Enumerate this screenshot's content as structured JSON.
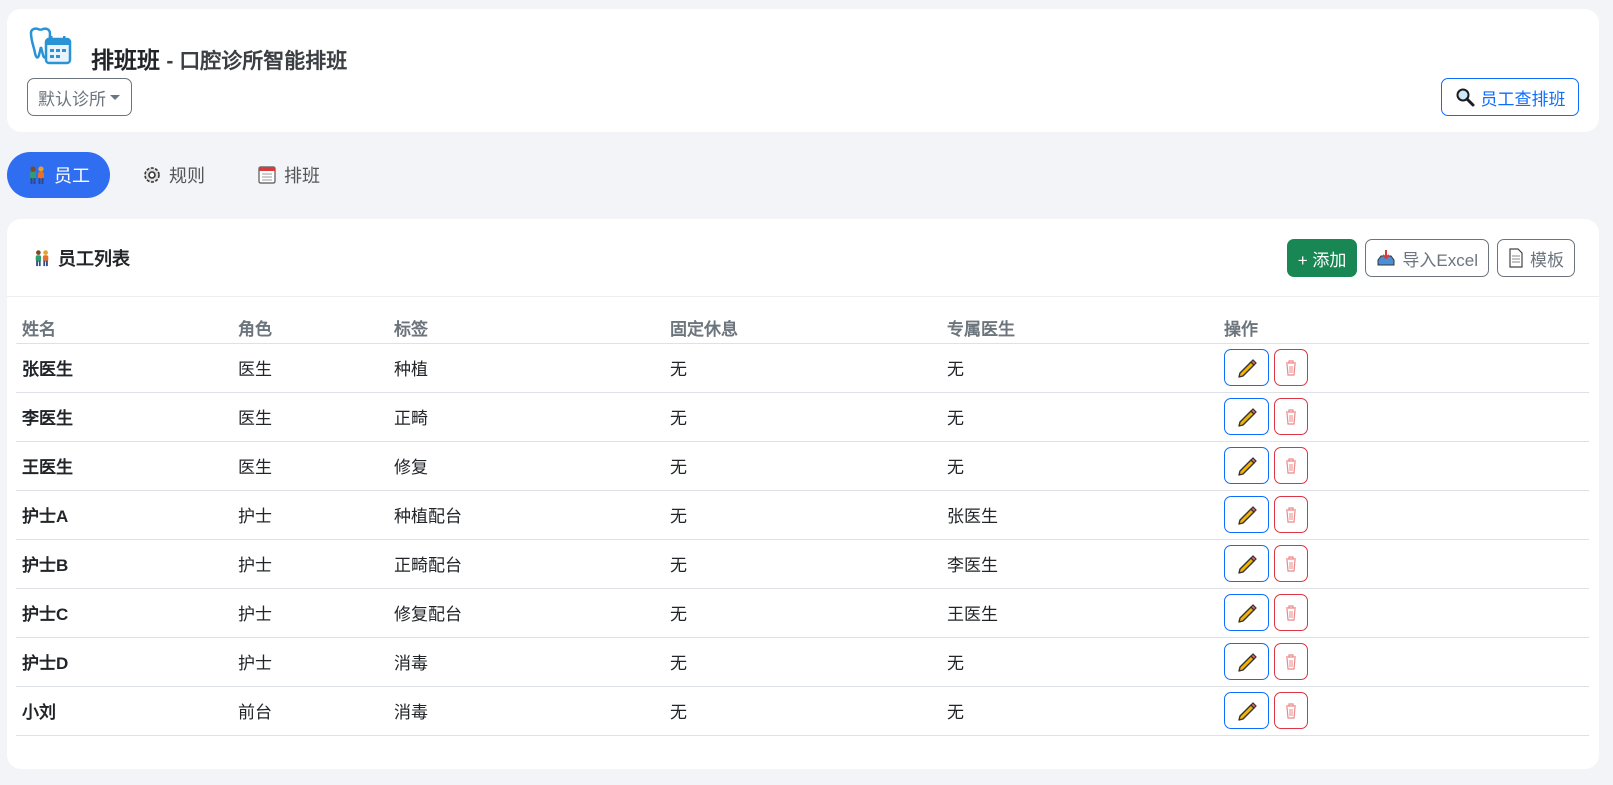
{
  "header": {
    "app_name": "排班班",
    "app_subtitle": "- 口腔诊所智能排班",
    "clinic_select": "默认诊所",
    "lookup_button": "员工查排班"
  },
  "tabs": [
    {
      "label": "员工",
      "icon": "people-icon",
      "active": true
    },
    {
      "label": "规则",
      "icon": "gear-icon",
      "active": false
    },
    {
      "label": "排班",
      "icon": "calendar-icon",
      "active": false
    }
  ],
  "staff_card": {
    "title": "员工列表",
    "add_button": "+ 添加",
    "import_button": "导入Excel",
    "template_button": "模板"
  },
  "table": {
    "columns": [
      "姓名",
      "角色",
      "标签",
      "固定休息",
      "专属医生",
      "操作"
    ],
    "rows": [
      {
        "name": "张医生",
        "role": "医生",
        "tag": "种植",
        "rest": "无",
        "doctor": "无"
      },
      {
        "name": "李医生",
        "role": "医生",
        "tag": "正畸",
        "rest": "无",
        "doctor": "无"
      },
      {
        "name": "王医生",
        "role": "医生",
        "tag": "修复",
        "rest": "无",
        "doctor": "无"
      },
      {
        "name": "护士A",
        "role": "护士",
        "tag": "种植配台",
        "rest": "无",
        "doctor": "张医生"
      },
      {
        "name": "护士B",
        "role": "护士",
        "tag": "正畸配台",
        "rest": "无",
        "doctor": "李医生"
      },
      {
        "name": "护士C",
        "role": "护士",
        "tag": "修复配台",
        "rest": "无",
        "doctor": "王医生"
      },
      {
        "name": "护士D",
        "role": "护士",
        "tag": "消毒",
        "rest": "无",
        "doctor": "无"
      },
      {
        "name": "小刘",
        "role": "前台",
        "tag": "消毒",
        "rest": "无",
        "doctor": "无"
      }
    ]
  },
  "colors": {
    "primary": "#2f6ef0",
    "success": "#198754",
    "danger": "#dc3545",
    "page_bg": "#f2f4f8"
  }
}
